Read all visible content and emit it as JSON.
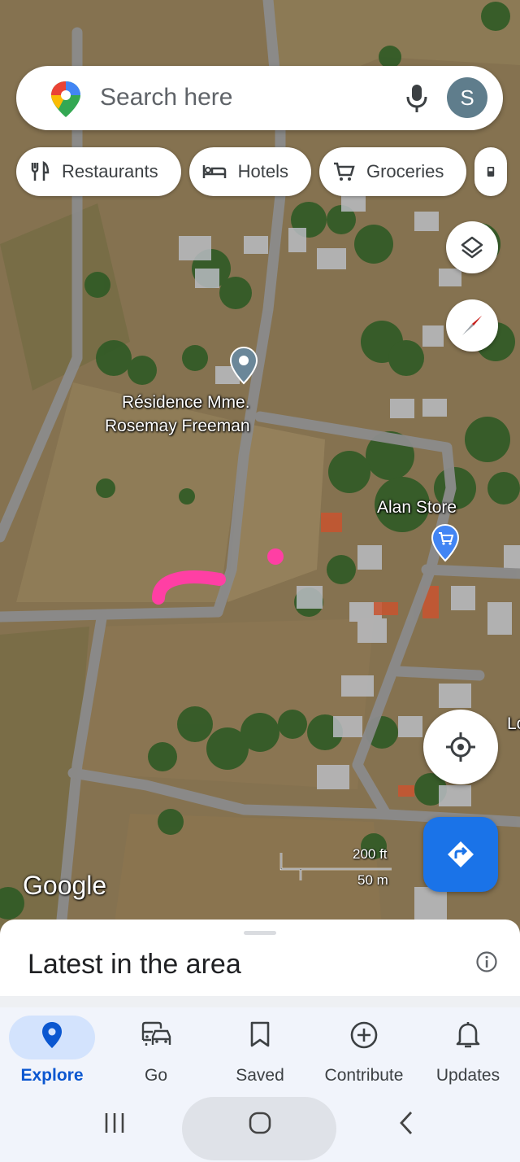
{
  "search": {
    "placeholder": "Search here",
    "avatar_letter": "S"
  },
  "chips": [
    {
      "label": "Restaurants",
      "icon": "fork-knife-icon"
    },
    {
      "label": "Hotels",
      "icon": "bed-icon"
    },
    {
      "label": "Groceries",
      "icon": "cart-icon"
    }
  ],
  "map": {
    "place_label_line1": "Résidence Mme.",
    "place_label_line2": "Rosemay Freeman",
    "store_label": "Alan Store",
    "edge_label": "Lo",
    "attribution": "Google",
    "scale_imperial": "200 ft",
    "scale_metric": "50 m"
  },
  "sheet": {
    "title": "Latest in the area"
  },
  "nav": {
    "items": [
      {
        "label": "Explore",
        "icon": "explore-pin-icon"
      },
      {
        "label": "Go",
        "icon": "commute-icon"
      },
      {
        "label": "Saved",
        "icon": "bookmark-icon"
      },
      {
        "label": "Contribute",
        "icon": "add-circle-icon"
      },
      {
        "label": "Updates",
        "icon": "bell-icon"
      }
    ]
  },
  "colors": {
    "accent": "#1a73e8",
    "active_text": "#0b57d0",
    "pill": "#d3e3fd",
    "road": "#8b8b8b",
    "marker": "#ff3fa4"
  }
}
